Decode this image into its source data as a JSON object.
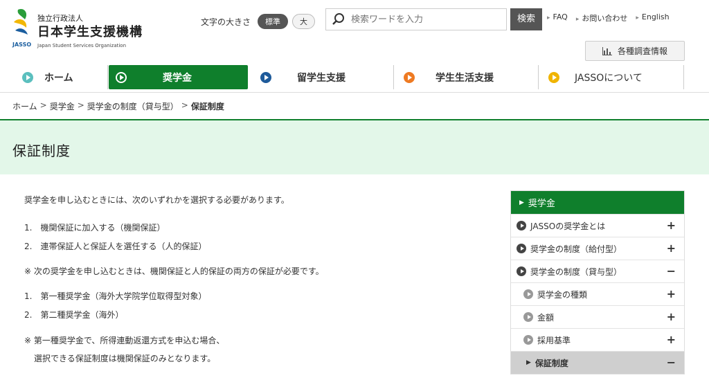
{
  "header": {
    "logo_sub": "独立行政法人",
    "logo_name": "日本学生支援機構",
    "logo_abbr": "JASSO",
    "logo_en": "Japan Student Services Organization",
    "font_size_label": "文字の大きさ",
    "font_size_options": [
      "標準",
      "大"
    ],
    "search_placeholder": "検索ワードを入力",
    "search_button": "検索",
    "top_links": [
      "FAQ",
      "お問い合わせ",
      "English"
    ],
    "survey_button": "各種調査情報"
  },
  "gnav": [
    {
      "label": "ホーム",
      "color": "#5bbfbe"
    },
    {
      "label": "奨学金",
      "color": "#ffffff"
    },
    {
      "label": "留学生支援",
      "color": "#1e5a9a"
    },
    {
      "label": "学生生活支援",
      "color": "#ee7a22"
    },
    {
      "label": "JASSOについて",
      "color": "#f0b400"
    }
  ],
  "breadcrumb": [
    "ホーム",
    "奨学金",
    "奨学金の制度（貸与型）",
    "保証制度"
  ],
  "page_title": "保証制度",
  "content": {
    "intro": "奨学金を申し込むときには、次のいずれかを選択する必要があります。",
    "list1": [
      "1.　機関保証に加入する（機関保証）",
      "2.　連帯保証人と保証人を選任する（人的保証）"
    ],
    "note1": "※ 次の奨学金を申し込むときは、機関保証と人的保証の両方の保証が必要です。",
    "list2": [
      "1.　第一種奨学金（海外大学院学位取得型対象）",
      "2.　第二種奨学金（海外）"
    ],
    "note2_line1": "※ 第一種奨学金で、所得連動返還方式を申込む場合、",
    "note2_line2": "選択できる保証制度は機関保証のみとなります。"
  },
  "sidebar": {
    "head": "奨学金",
    "items": [
      {
        "label": "JASSOの奨学金とは",
        "toggle": "+"
      },
      {
        "label": "奨学金の制度（給付型）",
        "toggle": "+"
      },
      {
        "label": "奨学金の制度（貸与型）",
        "toggle": "−"
      },
      {
        "label": "奨学金の種類",
        "toggle": "+"
      },
      {
        "label": "金額",
        "toggle": "+"
      },
      {
        "label": "採用基準",
        "toggle": "+"
      },
      {
        "label": "保証制度",
        "toggle": "−"
      }
    ]
  },
  "colors": {
    "brand_green": "#0f7f2c",
    "title_bg": "#e3f7e9"
  }
}
